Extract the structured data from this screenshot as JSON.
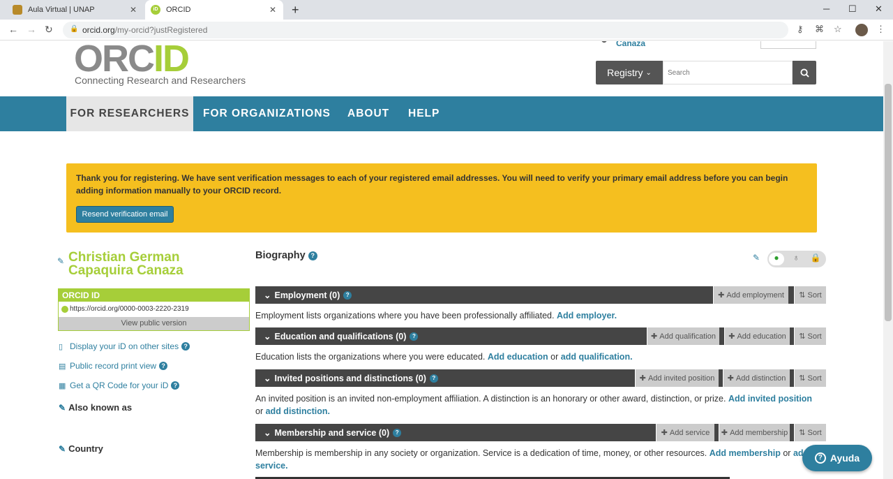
{
  "browser": {
    "tabs": [
      {
        "title": "Aula Virtual | UNAP"
      },
      {
        "title": "ORCID"
      }
    ],
    "url_host": "orcid.org",
    "url_path": "/my-orcid?justRegistered"
  },
  "header": {
    "logo_left": "ORC",
    "logo_right": "ID",
    "tagline": "Connecting Research and Researchers",
    "user_name_partial": "Canaza",
    "registry_label": "Registry",
    "search_placeholder": "Search"
  },
  "nav": {
    "items": [
      "FOR RESEARCHERS",
      "FOR ORGANIZATIONS",
      "ABOUT",
      "HELP"
    ]
  },
  "alert": {
    "message": "Thank you for registering. We have sent verification messages to each of your registered email addresses. You will need to verify your primary email address before you can begin adding information manually to your ORCID record.",
    "button": "Resend verification email"
  },
  "sidebar": {
    "name_line1": "Christian German",
    "name_line2": "Capaquira Canaza",
    "orcid_header": "ORCID ID",
    "orcid_uri": "https://orcid.org/0000-0003-2220-2319",
    "view_public": "View public version",
    "links": [
      "Display your iD on other sites",
      "Public record print view",
      "Get a QR Code for your iD"
    ],
    "also_known_as": "Also known as",
    "country": "Country"
  },
  "main": {
    "biography": "Biography",
    "sections": [
      {
        "title": "Employment (0)",
        "buttons": [
          "Add employment",
          "Sort"
        ],
        "desc": "Employment lists organizations where you have been professionally affiliated.",
        "link1": "Add employer.",
        "mid": "",
        "link2": ""
      },
      {
        "title": "Education and qualifications (0)",
        "buttons": [
          "Add qualification",
          "Add education",
          "Sort"
        ],
        "desc": "Education lists the organizations where you were educated.",
        "link1": "Add education",
        "mid": "or",
        "link2": "add qualification."
      },
      {
        "title": "Invited positions and distinctions (0)",
        "buttons": [
          "Add invited position",
          "Add distinction",
          "Sort"
        ],
        "desc": "An invited position is an invited non-employment affiliation. A distinction is an honorary or other award, distinction, or prize.",
        "link1": "Add invited position",
        "mid": "or",
        "link2": "add distinction."
      },
      {
        "title": "Membership and service (0)",
        "buttons": [
          "Add service",
          "Add membership",
          "Sort"
        ],
        "desc": "Membership is membership in any society or organization. Service is a dedication of time, money, or other resources.",
        "link1": "Add membership",
        "mid": "or",
        "link2": "add service."
      }
    ]
  },
  "help_button": "Ayuda"
}
